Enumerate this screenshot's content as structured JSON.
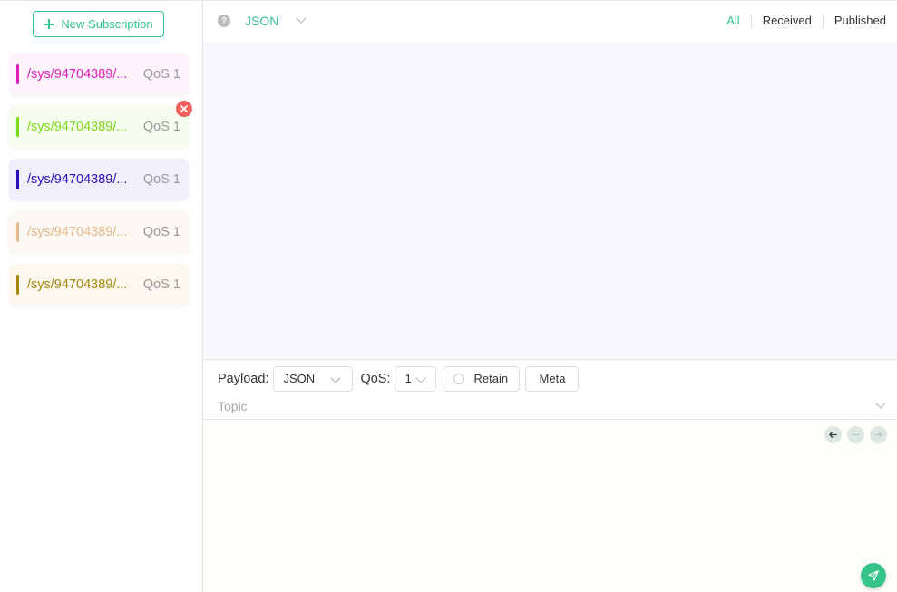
{
  "sidebar": {
    "new_subscription_label": "New Subscription",
    "subscriptions": [
      {
        "topic": "/sys/94704389/...",
        "qos": "QoS 1",
        "color": "#e01ebd",
        "bg": "#fcf3fb"
      },
      {
        "topic": "/sys/94704389/...",
        "qos": "QoS 1",
        "color": "#7ed81b",
        "bg": "#f5fdef"
      },
      {
        "topic": "/sys/94704389/...",
        "qos": "QoS 1",
        "color": "#2a10b8",
        "bg": "#eff0fb"
      },
      {
        "topic": "/sys/94704389/...",
        "qos": "QoS 1",
        "color": "#e3b98d",
        "bg": "#fcf8f3"
      },
      {
        "topic": "/sys/94704389/...",
        "qos": "QoS 1",
        "color": "#a6880d",
        "bg": "#faf8ef"
      }
    ]
  },
  "topbar": {
    "format_value": "JSON",
    "filters": [
      "All",
      "Received",
      "Published"
    ],
    "active_filter": "All"
  },
  "composer": {
    "payload_label": "Payload:",
    "payload_format": "JSON",
    "qos_label": "QoS:",
    "qos_value": "1",
    "retain_label": "Retain",
    "meta_label": "Meta",
    "topic_placeholder": "Topic"
  },
  "colors": {
    "accent": "#34c388",
    "danger": "#f0605c"
  }
}
